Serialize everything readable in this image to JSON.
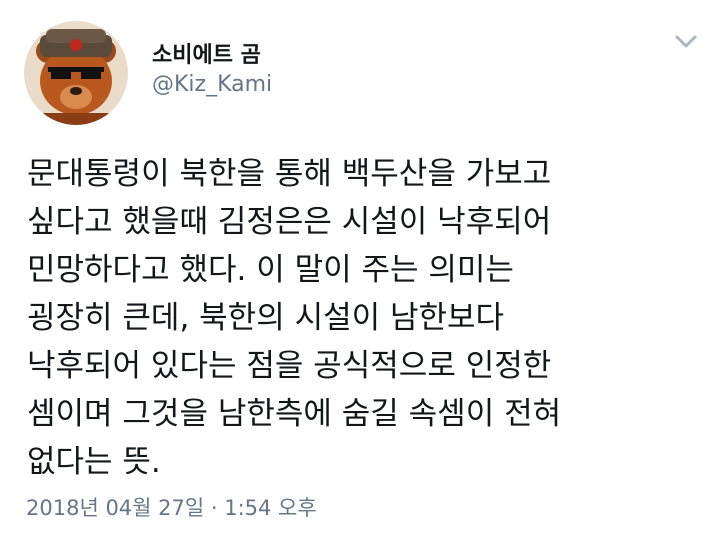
{
  "author": {
    "display_name": "소비에트 곰",
    "handle": "@Kiz_Kami",
    "avatar_icon": "bear-avatar-icon"
  },
  "tweet": {
    "lines": [
      "문대통령이 북한을 통해 백두산을 가보고",
      "싶다고 했을때 김정은은 시설이 낙후되어",
      "민망하다고 했다. 이 말이 주는 의미는",
      "굉장히 큰데, 북한의 시설이 남한보다",
      "낙후되어 있다는 점을 공식적으로 인정한",
      "셈이며 그것을 남한측에 숨길 속셈이 전혀",
      "없다는 뜻."
    ],
    "timestamp": "2018년 04월 27일 · 1:54 오후"
  },
  "colors": {
    "text": "#14171a",
    "secondary": "#657786",
    "chevron": "#aab8c2"
  }
}
